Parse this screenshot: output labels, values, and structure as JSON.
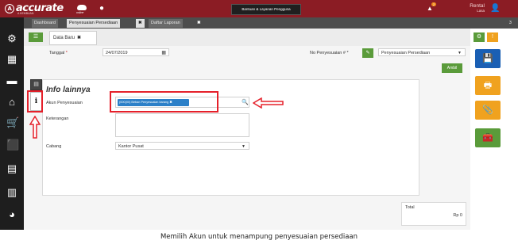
{
  "app": {
    "logo": "accurate",
    "logo_sub": "A KEMBUAN",
    "online": "online",
    "help_button": "Bantuan & Layanan Pengguna",
    "notification_count": "2",
    "user_line1": "Rental",
    "user_line2": "Lasa",
    "tab_count": "3"
  },
  "tabs": {
    "dashboard": "Dashboard",
    "penyesuaian": "Penyesuaian Persediaan",
    "close1": "✖",
    "daftar": "Daftar Laporan",
    "close2": "✖"
  },
  "form": {
    "doc_tab": "Data Baru",
    "doc_tab_close": "✖",
    "tanggal_label": "Tanggal",
    "required_mark": " *",
    "tanggal_value": "24/07/2019",
    "no_label": "No Penyesuaian # *",
    "no_value": "Penyesuaian Persediaan",
    "ambil_button": "Ambil",
    "section_title": "Info lainnya",
    "akun_label": "Akun Penyesuaian",
    "akun_tag": "(000(00) Beban Penyesuaian barang",
    "akun_tag_close": "✖",
    "keterangan_label": "Keterangan",
    "cabang_label": "Cabang",
    "cabang_value": "Kantor Pusat",
    "total_label": "Total",
    "total_value": "Rp 0"
  },
  "caption": "Memilih Akun untuk menampung penyesuaian persediaan",
  "colors": {
    "brand": "#8b1c24",
    "green": "#5a9b3a",
    "blue_action": "#1a5fb4",
    "orange_action": "#f0a21f",
    "annotation_red": "#e5202a"
  },
  "icons": {
    "sidebar": [
      "gear-icon",
      "building-icon",
      "card-icon",
      "bank-icon",
      "cart-icon",
      "bag-icon",
      "cabinet-icon",
      "factory-icon",
      "chart-icon"
    ],
    "right": [
      "save-icon",
      "print-icon",
      "attach-icon",
      "toolbox-icon"
    ]
  }
}
